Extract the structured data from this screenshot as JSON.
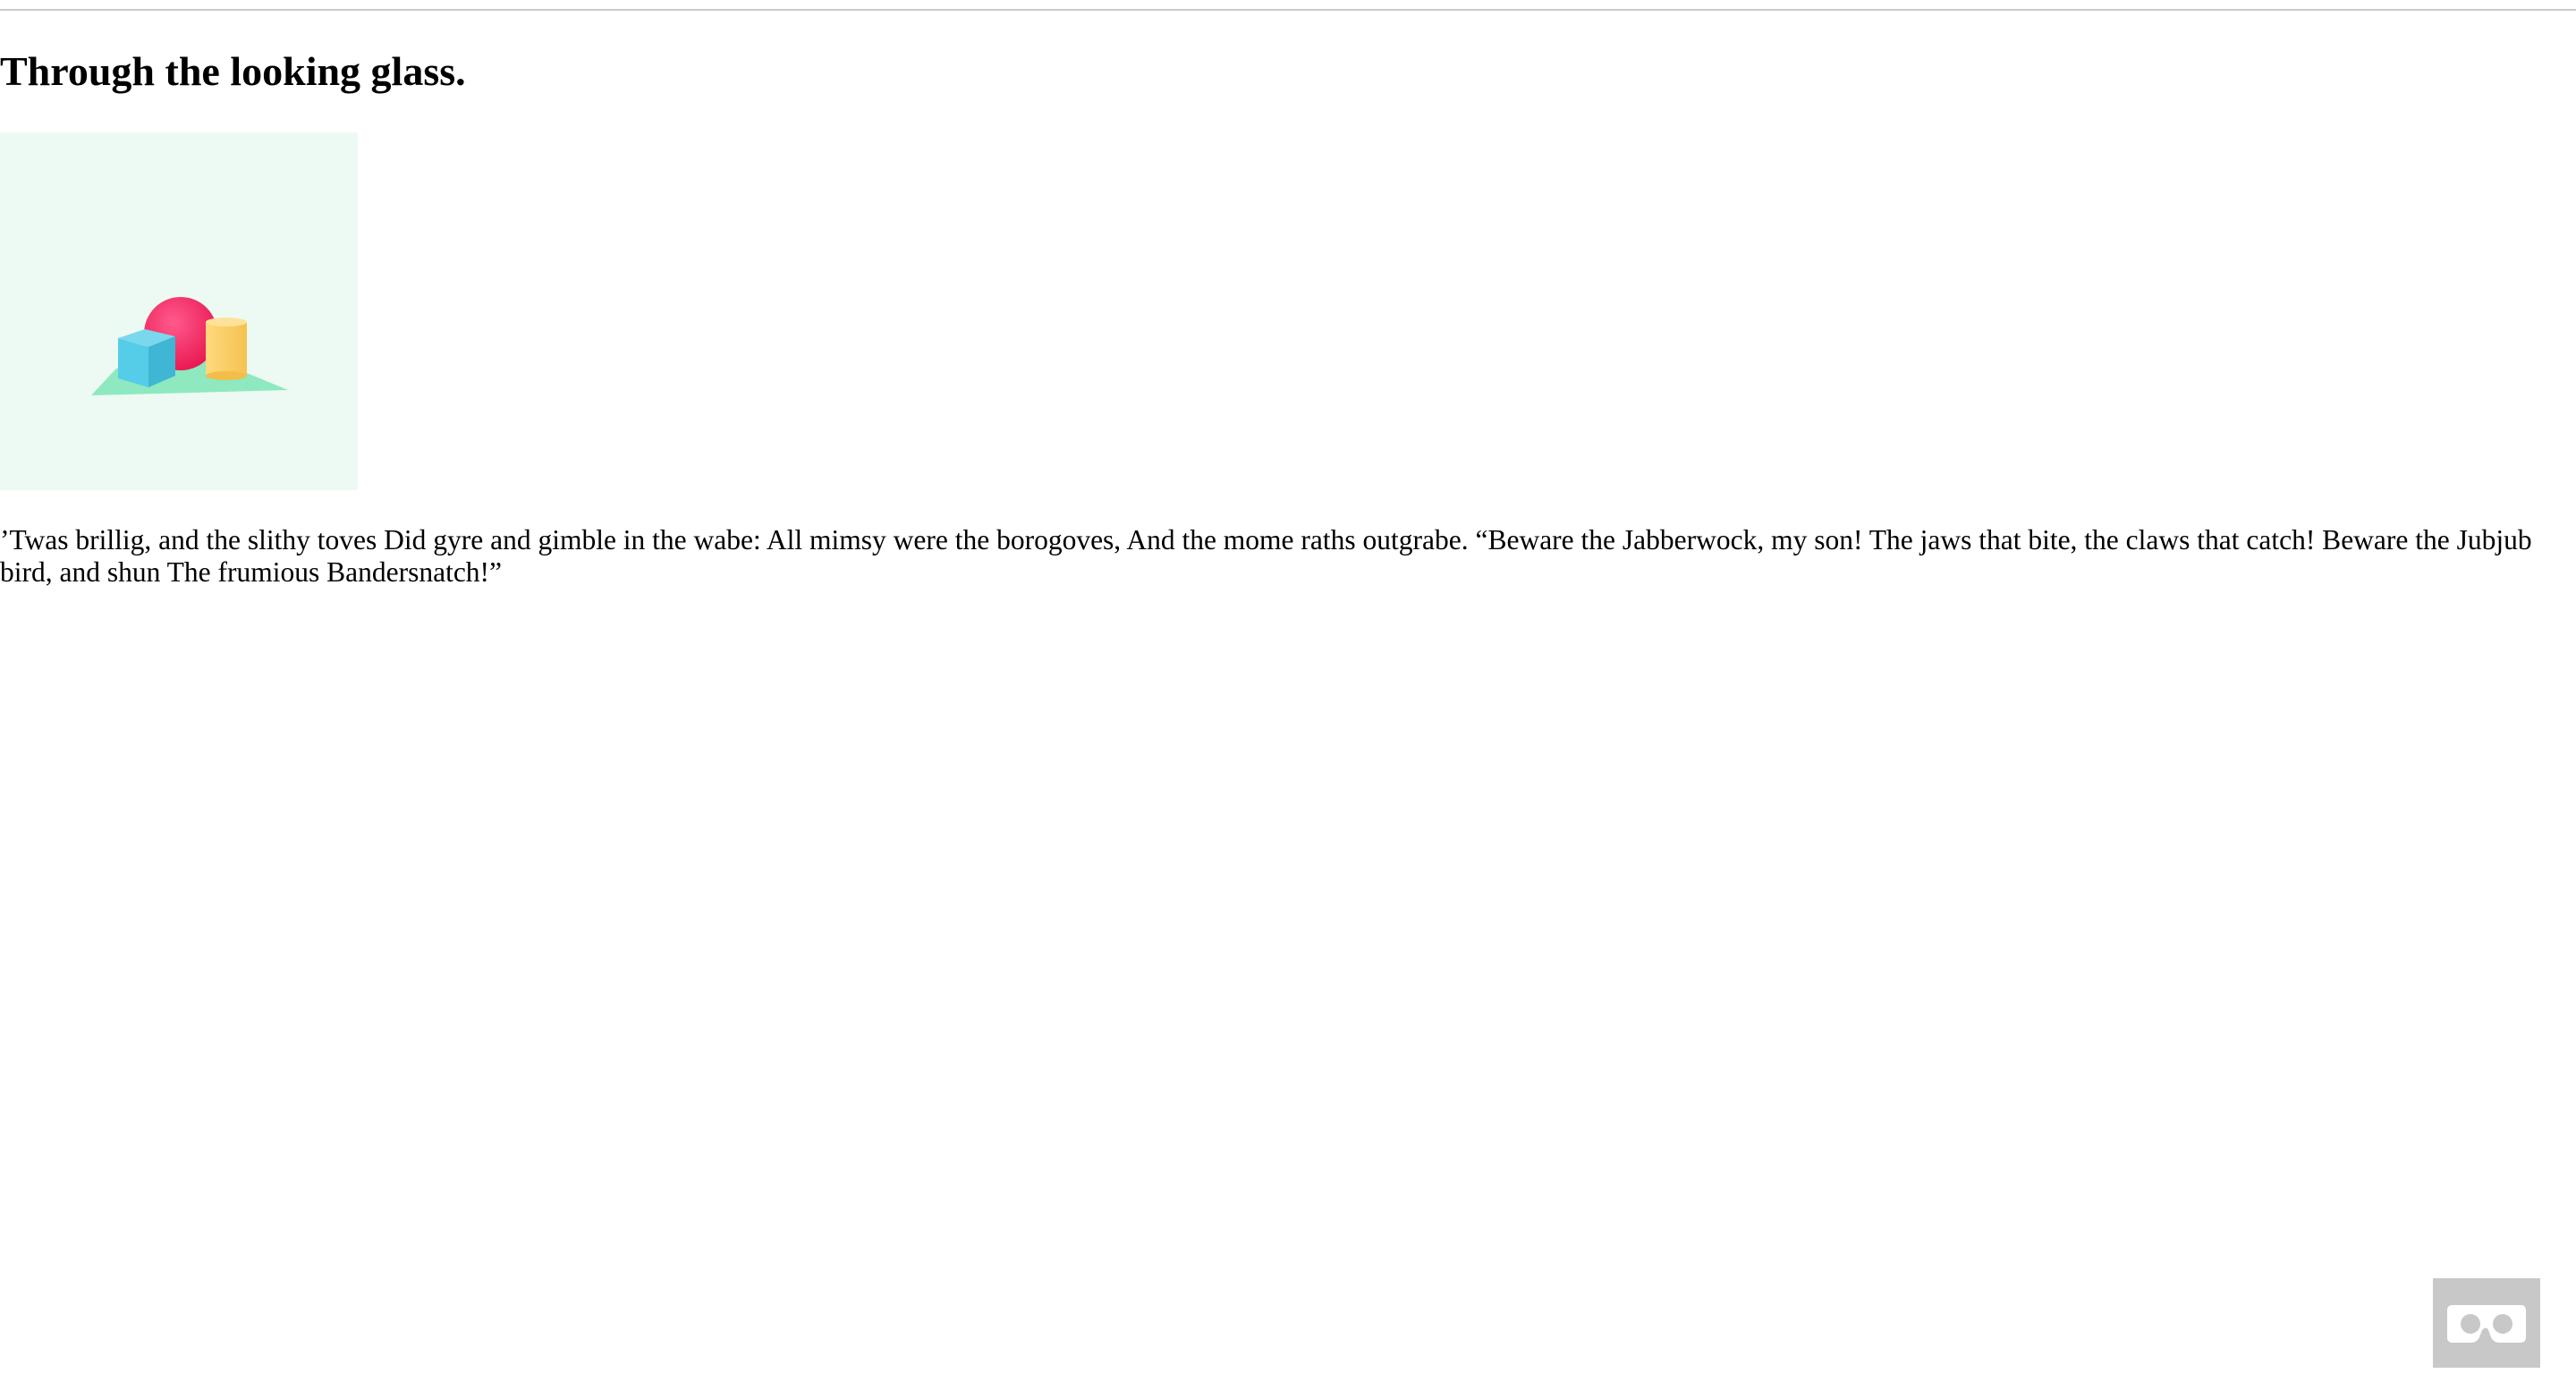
{
  "page": {
    "title": "Through the looking glass.",
    "poem_line1": "’Twas brillig, and the slithy toves Did gyre and gimble in the wabe: All mimsy were the borogoves, And the mome raths outgrabe. “Beware the Jabberwock, my son! The jaws that bite, the claws that catch! Beware the Jubjub",
    "poem_line2": "bird, and shun The frumious Bandersnatch!”"
  },
  "scene": {
    "background": "#ecfaf3",
    "plane_color": "#8ee8c0",
    "sphere_color": "#ff2d6b",
    "cube_color": "#4fcbe6",
    "cylinder_color": "#ffd26a"
  },
  "vr_button": {
    "icon": "vr-headset-icon",
    "background": "#c8c8c8"
  }
}
